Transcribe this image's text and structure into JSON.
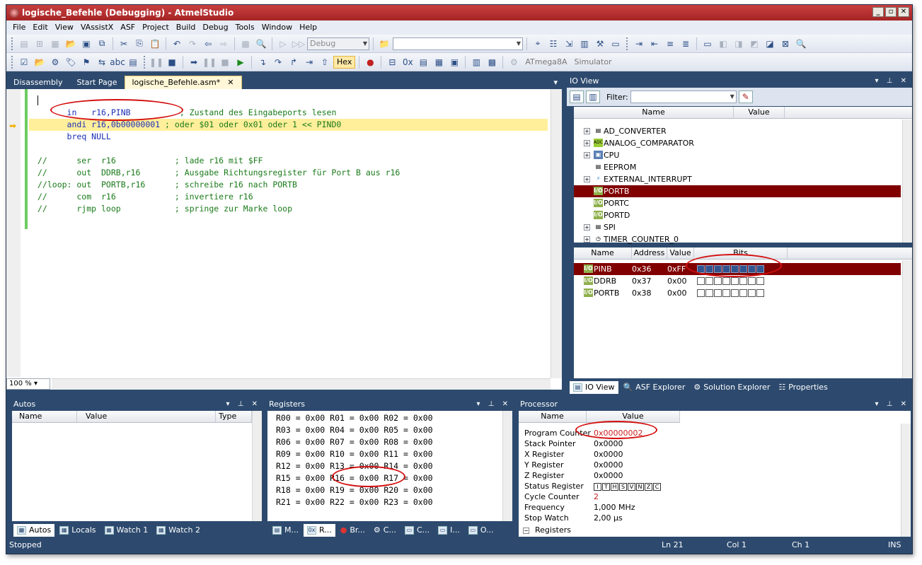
{
  "window": {
    "title": "logische_Befehle (Debugging) - AtmelStudio"
  },
  "menu": [
    "File",
    "Edit",
    "View",
    "VAssistX",
    "ASF",
    "Project",
    "Build",
    "Debug",
    "Tools",
    "Window",
    "Help"
  ],
  "toolbar": {
    "config": "Debug",
    "hex_label": "Hex",
    "device": "ATmega8A",
    "tool": "Simulator"
  },
  "doc_tabs": [
    {
      "label": "Disassembly"
    },
    {
      "label": "Start Page"
    },
    {
      "label": "logische_Befehle.asm*",
      "close": "✕"
    }
  ],
  "editor": {
    "zoom": "100 %",
    "lines": [
      {
        "code": "",
        "comment": ""
      },
      {
        "code": "in   r16,PINB",
        "comment": "; Zustand des Eingabeports lesen"
      },
      {
        "code": "andi r16,0b00000001",
        "comment": "; oder $01 oder 0x01 oder 1 << PIND0"
      },
      {
        "code": "breq NULL",
        "comment": ""
      },
      {
        "code": "",
        "comment": ""
      },
      {
        "code": "",
        "comment": "//      ser  r16            ; lade r16 mit $FF"
      },
      {
        "code": "",
        "comment": "//      out  DDRB,r16       ; Ausgabe Richtungsregister für Port B aus r16"
      },
      {
        "code": "",
        "comment": "//loop: out  PORTB,r16      ; schreibe r16 nach PORTB"
      },
      {
        "code": "",
        "comment": "//      com  r16            ; invertiere r16"
      },
      {
        "code": "",
        "comment": "//      rjmp loop           ; springe zur Marke loop"
      }
    ]
  },
  "io_view": {
    "title": "IO View",
    "filter_label": "Filter:",
    "tree_headers": {
      "name": "Name",
      "value": "Value"
    },
    "tree": [
      {
        "label": "AD_CONVERTER",
        "expand": "+"
      },
      {
        "label": "ANALOG_COMPARATOR",
        "expand": "+"
      },
      {
        "label": "CPU",
        "expand": "+"
      },
      {
        "label": "EEPROM",
        "expand": ""
      },
      {
        "label": "EXTERNAL_INTERRUPT",
        "expand": "+"
      },
      {
        "label": "PORTB",
        "expand": "",
        "selected": true
      },
      {
        "label": "PORTC",
        "expand": ""
      },
      {
        "label": "PORTD",
        "expand": ""
      },
      {
        "label": "SPI",
        "expand": "+"
      },
      {
        "label": "TIMER_COUNTER_0",
        "expand": "+"
      }
    ],
    "reg_headers": {
      "name": "Name",
      "address": "Address",
      "value": "Value",
      "bits": "Bits"
    },
    "registers": [
      {
        "name": "PINB",
        "address": "0x36",
        "value": "0xFF",
        "bits": [
          1,
          1,
          1,
          1,
          1,
          1,
          1,
          1
        ]
      },
      {
        "name": "DDRB",
        "address": "0x37",
        "value": "0x00",
        "bits": [
          0,
          0,
          0,
          0,
          0,
          0,
          0,
          0
        ]
      },
      {
        "name": "PORTB",
        "address": "0x38",
        "value": "0x00",
        "bits": [
          0,
          0,
          0,
          0,
          0,
          0,
          0,
          0
        ]
      }
    ],
    "tabs": [
      "IO View",
      "ASF Explorer",
      "Solution Explorer",
      "Properties"
    ]
  },
  "autos": {
    "title": "Autos",
    "headers": {
      "name": "Name",
      "value": "Value",
      "type": "Type"
    },
    "tabs": [
      "Autos",
      "Locals",
      "Watch 1",
      "Watch 2"
    ]
  },
  "registers": {
    "title": "Registers",
    "lines": [
      "R00 = 0x00 R01 = 0x00 R02 = 0x00",
      "R03 = 0x00 R04 = 0x00 R05 = 0x00",
      "R06 = 0x00 R07 = 0x00 R08 = 0x00",
      "R09 = 0x00 R10 = 0x00 R11 = 0x00",
      "R12 = 0x00 R13 = 0x00 R14 = 0x00",
      "R15 = 0x00 R16 = 0x00 R17 = 0x00",
      "R18 = 0x00 R19 = 0x00 R20 = 0x00",
      "R21 = 0x00 R22 = 0x00 R23 = 0x00"
    ],
    "tabs": [
      "M...",
      "R...",
      "Br...",
      "C...",
      "C...",
      "I...",
      "O..."
    ]
  },
  "processor": {
    "title": "Processor",
    "headers": {
      "name": "Name",
      "value": "Value"
    },
    "rows": [
      {
        "name": "Program Counter",
        "value": "0x00000002",
        "changed": true
      },
      {
        "name": "Stack Pointer",
        "value": "0x0000"
      },
      {
        "name": "X Register",
        "value": "0x0000"
      },
      {
        "name": "Y Register",
        "value": "0x0000"
      },
      {
        "name": "Z Register",
        "value": "0x0000"
      },
      {
        "name": "Status Register",
        "value": ""
      },
      {
        "name": "Cycle Counter",
        "value": "2",
        "changed": true
      },
      {
        "name": "Frequency",
        "value": "1,000 MHz"
      },
      {
        "name": "Stop Watch",
        "value": "2,00 µs"
      }
    ],
    "sreg_flags": [
      "I",
      "T",
      "H",
      "S",
      "V",
      "N",
      "Z",
      "C"
    ],
    "registers_node": "Registers"
  },
  "status": {
    "state": "Stopped",
    "ln": "Ln 21",
    "col": "Col 1",
    "ch": "Ch 1",
    "mode": "INS"
  }
}
